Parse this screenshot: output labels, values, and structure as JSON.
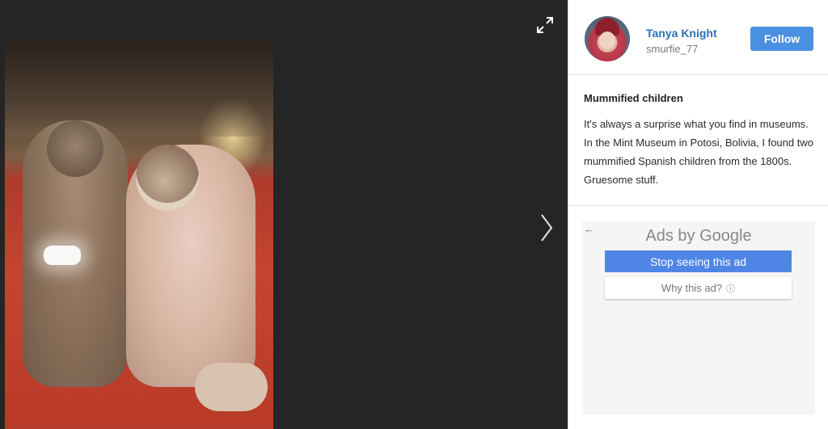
{
  "viewer": {
    "image_alt": "Mummified children photo",
    "expand_icon": "expand-icon",
    "next_icon": "chevron-right-icon"
  },
  "profile": {
    "name": "Tanya Knight",
    "handle": "smurfie_77",
    "follow_label": "Follow"
  },
  "post": {
    "title": "Mummified children",
    "body": "It's always a surprise what you find in museums. In the Mint Museum in Potosi, Bolivia, I found two mummified Spanish children from the 1800s. Gruesome stuff."
  },
  "ad": {
    "back_arrow": "←",
    "ads_by_label": "Ads by Google",
    "stop_label": "Stop seeing this ad",
    "why_label": "Why this ad?",
    "why_info_glyph": "ⓘ"
  },
  "colors": {
    "accent": "#4a90e2",
    "name_link": "#2f6fb5",
    "viewer_bg": "#252526"
  }
}
